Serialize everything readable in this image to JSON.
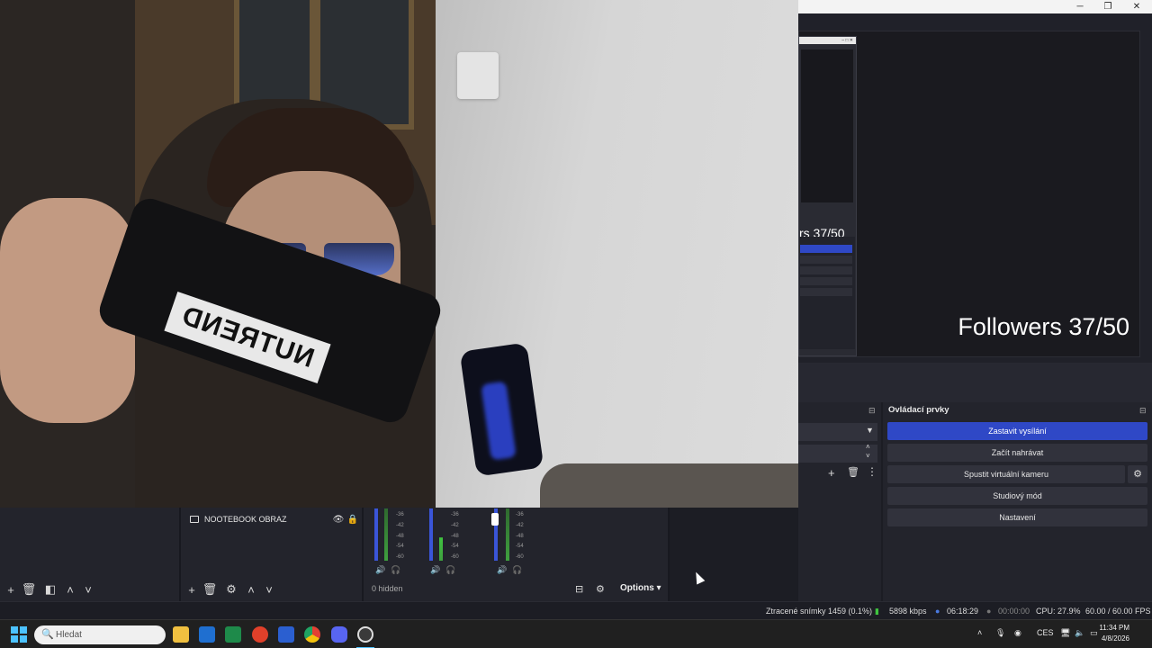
{
  "window": {
    "controls": {
      "minimize": "─",
      "maximize": "❐",
      "close": "✕"
    }
  },
  "preview": {
    "followers_text": "Followers  37/50",
    "mini_followers_text": "rs  37/50"
  },
  "webcam": {
    "mic_brand": "NUTREND"
  },
  "sources": {
    "items": [
      {
        "name": "NOOTEBOOK OBRAZ"
      }
    ]
  },
  "mixer": {
    "tick_labels": [
      "-36",
      "-42",
      "-48",
      "-54",
      "-60"
    ],
    "hidden_label": "0 hidden",
    "options_label": "Options"
  },
  "controls": {
    "title": "Ovládací prvky",
    "buttons": {
      "stop_stream": "Zastavit vysílání",
      "start_recording": "Začít nahrávat",
      "virtual_camera": "Spustit virtuální kameru",
      "studio_mode": "Studiový mód",
      "settings": "Nastavení"
    }
  },
  "status": {
    "dropped_frames": "Ztracené snímky 1459 (0.1%)",
    "bitrate": "5898 kbps",
    "stream_time": "06:18:29",
    "record_time": "00:00:00",
    "cpu": "CPU: 27.9%",
    "fps": "60.00 / 60.00 FPS"
  },
  "taskbar": {
    "search_placeholder": "Hledat",
    "language": "CES",
    "time": "11:34 PM",
    "date": "4/8/2026"
  },
  "colors": {
    "primary_button": "#2f48c6",
    "background": "#1c1d24",
    "dock": "#23242c"
  }
}
